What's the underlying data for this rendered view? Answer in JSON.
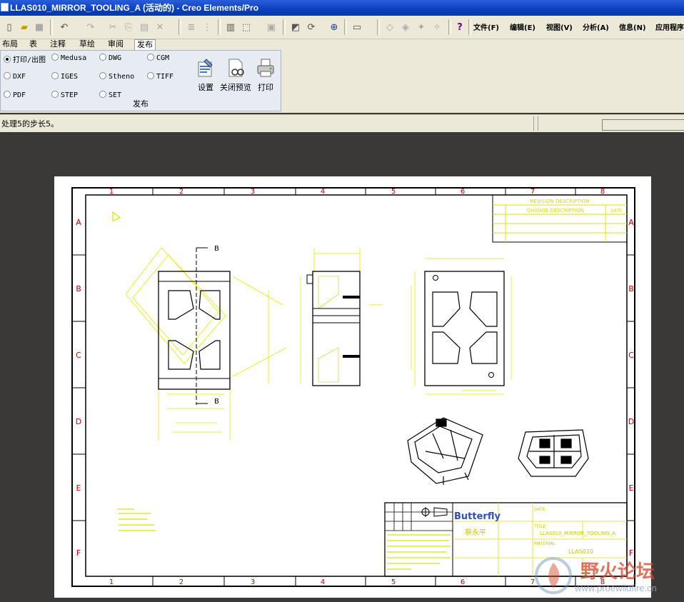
{
  "window": {
    "title": "LLAS010_MIRROR_TOOLING_A (活动的) - Creo Elements/Pro"
  },
  "menubar": {
    "items": [
      "文件(F)",
      "编辑(E)",
      "视图(V)",
      "分析(A)",
      "信息(N)",
      "应用程序"
    ]
  },
  "toolbar_icons": [
    "new-icon",
    "open-icon",
    "save-icon",
    "undo-icon",
    "redo-icon",
    "cut-icon",
    "copy-icon",
    "paste-icon",
    "delete-icon",
    "layer-icon",
    "model-tree-icon",
    "find-icon",
    "select-box-icon",
    "properties-icon",
    "repaint-icon",
    "redraw-icon",
    "zoom-icon",
    "view-icon",
    "text-style-icon",
    "hatch-icon",
    "symbol-icon",
    "help-icon"
  ],
  "tabs": {
    "items": [
      "布局",
      "表",
      "注释",
      "草绘",
      "审阅",
      "发布"
    ],
    "active": "发布"
  },
  "publish_panel": {
    "formats": [
      {
        "label": "打印/出图",
        "selected": true
      },
      {
        "label": "Medusa",
        "selected": false
      },
      {
        "label": "DWG",
        "selected": false
      },
      {
        "label": "CGM",
        "selected": false
      },
      {
        "label": "DXF",
        "selected": false
      },
      {
        "label": "IGES",
        "selected": false
      },
      {
        "label": "Stheno",
        "selected": false
      },
      {
        "label": "TIFF",
        "selected": false
      },
      {
        "label": "PDF",
        "selected": false
      },
      {
        "label": "STEP",
        "selected": false
      },
      {
        "label": "SET",
        "selected": false
      }
    ],
    "buttons": [
      {
        "label": "设置"
      },
      {
        "label": "关闭预览"
      },
      {
        "label": "打印"
      }
    ],
    "group_label": "发布"
  },
  "status": {
    "message": "处理5的步长5。"
  },
  "drawing": {
    "col_labels": [
      "1",
      "2",
      "3",
      "4",
      "5",
      "6",
      "7",
      "8"
    ],
    "row_labels": [
      "A",
      "B",
      "C",
      "D",
      "E",
      "F"
    ],
    "section_marks": [
      "B",
      "B"
    ],
    "revision_title": "REVISION DESCRIPTION",
    "revision_change": "CHANGE DESCRIPTION",
    "revision_date": "DATE",
    "company": "Butterfly",
    "owner_name": "蔡永平",
    "title_label": "TITLE",
    "drawing_title": "LLAS010_MIRROR_TOOLING_A",
    "material_label": "MATERIAL",
    "part_code": "LLAS010",
    "date_label": "DATE",
    "watermark_cn": "野火论坛",
    "watermark_url": "www.proewildfire.cn"
  },
  "colors": {
    "title_bar": "#0a3fc0",
    "drawing_yellow": "#e8e800",
    "drawing_red": "#c80000",
    "panel_bg": "#e7ecf3"
  }
}
